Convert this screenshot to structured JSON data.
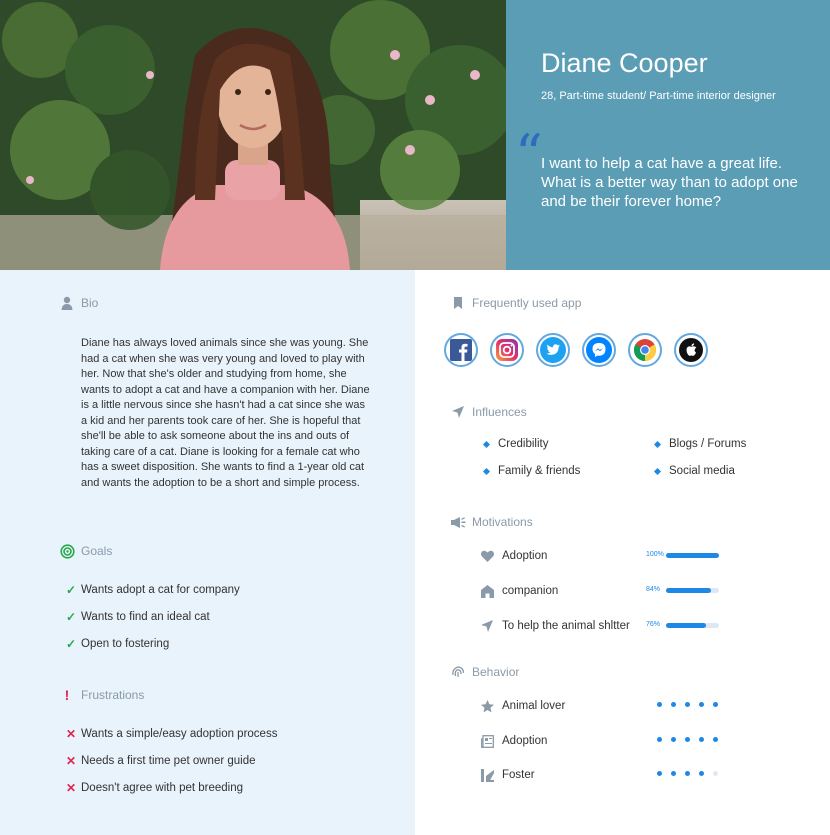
{
  "profile": {
    "name": "Diane Cooper",
    "subtitle": "28, Part-time student/ Part-time interior designer",
    "quote": "I want to help a cat have a great life. What is a better way than to adopt one and be their forever home?"
  },
  "bio": {
    "heading": "Bio",
    "text": "Diane has always loved animals since she was young. She had a cat when she was very young and loved to play with her. Now that she's older and studying from home, she wants to adopt a cat and have a companion with her. Diane is a little nervous since she hasn't had a cat since she was a kid and her parents took care of her. She is hopeful that she'll be able to ask someone about the ins and outs of taking care of a cat. Diane is looking for a female cat who has a sweet disposition. She wants to find a 1-year old cat and wants the adoption to be a short and simple process."
  },
  "goals": {
    "heading": "Goals",
    "items": [
      "Wants adopt a cat for company",
      "Wants to find an ideal cat",
      "Open to fostering"
    ]
  },
  "frustrations": {
    "heading": "Frustrations",
    "items": [
      "Wants a simple/easy adoption process",
      "Needs a first time pet owner guide",
      "Doesn't agree with pet breeding"
    ]
  },
  "apps": {
    "heading": "Frequently used app",
    "icons": [
      "facebook-icon",
      "instagram-icon",
      "twitter-icon",
      "messenger-icon",
      "chrome-icon",
      "apple-icon"
    ]
  },
  "influences": {
    "heading": "Influences",
    "items": [
      "Credibility",
      "Blogs / Forums",
      "Family & friends",
      "Social media"
    ]
  },
  "motivations": {
    "heading": "Motivations",
    "items": [
      {
        "label": "Adoption",
        "percent_text": "100%",
        "value": 100,
        "icon": "heart-icon"
      },
      {
        "label": "companion",
        "percent_text": "84%",
        "value": 84,
        "icon": "home-icon"
      },
      {
        "label": "To help the animal shltter",
        "percent_text": "76%",
        "value": 76,
        "icon": "navigation-icon"
      }
    ]
  },
  "behavior": {
    "heading": "Behavior",
    "items": [
      {
        "label": "Animal lover",
        "rating": 5,
        "max": 5,
        "icon": "star-icon"
      },
      {
        "label": "Adoption",
        "rating": 5,
        "max": 5,
        "icon": "news-icon"
      },
      {
        "label": "Foster",
        "rating": 4,
        "max": 5,
        "icon": "chart-icon"
      }
    ]
  },
  "colors": {
    "header_bg": "#5b9db5",
    "accent": "#1e88e5",
    "left_bg": "#e8f3fb",
    "check": "#29a84a",
    "cross": "#e2264d"
  }
}
